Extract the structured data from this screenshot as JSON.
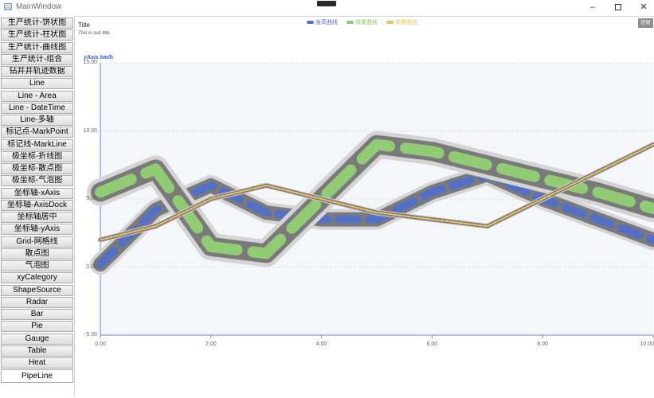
{
  "window": {
    "title": "MainWindow"
  },
  "sidebar": {
    "items": [
      {
        "label": "生产统计-饼状图"
      },
      {
        "label": "生产统计-柱状图"
      },
      {
        "label": "生产统计-曲线图"
      },
      {
        "label": "生产统计-组合"
      },
      {
        "label": "钻井井轨迹数据"
      },
      {
        "label": "Line"
      },
      {
        "label": "Line - Area"
      },
      {
        "label": "Line - DateTime"
      },
      {
        "label": "Line-多轴"
      },
      {
        "label": "标记点-MarkPoint"
      },
      {
        "label": "标记线-MarkLine"
      },
      {
        "label": "极坐标-折线图"
      },
      {
        "label": "极坐标-散点图"
      },
      {
        "label": "极坐标-气泡图"
      },
      {
        "label": "坐标轴-xAxis"
      },
      {
        "label": "坐标轴-AxisDock"
      },
      {
        "label": "坐标轴居中"
      },
      {
        "label": "坐标轴-yAxis"
      },
      {
        "label": "Grid-网格线"
      },
      {
        "label": "散点图"
      },
      {
        "label": "气泡图"
      },
      {
        "label": "xyCategory"
      },
      {
        "label": "ShapeSource"
      },
      {
        "label": "Radar"
      },
      {
        "label": "Bar"
      },
      {
        "label": "Pie"
      },
      {
        "label": "Gauge"
      },
      {
        "label": "Table"
      },
      {
        "label": "Heat"
      },
      {
        "label": "PipeLine"
      }
    ],
    "active_index": 29
  },
  "toolbar": {
    "reset_label": "还原"
  },
  "chart_data": {
    "type": "line",
    "title": "Title",
    "subtitle": "This is sub title",
    "ylabel": "yAxis km/h",
    "xlim": [
      0,
      10
    ],
    "ylim": [
      -5,
      15
    ],
    "xticks": [
      "0.00",
      "2.00",
      "4.00",
      "6.00",
      "8.00",
      "10.00"
    ],
    "yticks": [
      "-5.00",
      "0.00",
      "5.00",
      "10.00",
      "15.00"
    ],
    "grid": true,
    "legend_position": "top-center",
    "series": [
      {
        "name": "身高曲线",
        "color": "#5470c6",
        "x": [
          0,
          1,
          2,
          3,
          4,
          5,
          6,
          7,
          8,
          9,
          10
        ],
        "y": [
          0.2,
          4.2,
          6.0,
          4.0,
          3.5,
          3.5,
          5.5,
          6.8,
          5.0,
          3.5,
          2.0
        ]
      },
      {
        "name": "体重曲线",
        "color": "#91cc75",
        "x": [
          0,
          1,
          2,
          3,
          4,
          5,
          6,
          7,
          8,
          9,
          10
        ],
        "y": [
          5.5,
          7.2,
          1.5,
          1.0,
          5.0,
          9.0,
          8.5,
          7.5,
          6.5,
          5.5,
          4.3
        ]
      },
      {
        "name": "体重曲线",
        "color": "#f4c15e",
        "x": [
          0,
          1,
          2,
          3,
          4,
          5,
          6,
          7,
          8,
          9,
          10
        ],
        "y": [
          2.0,
          3.0,
          5.0,
          6.0,
          5.0,
          4.0,
          3.5,
          3.0,
          5.0,
          7.0,
          9.0
        ]
      }
    ]
  }
}
